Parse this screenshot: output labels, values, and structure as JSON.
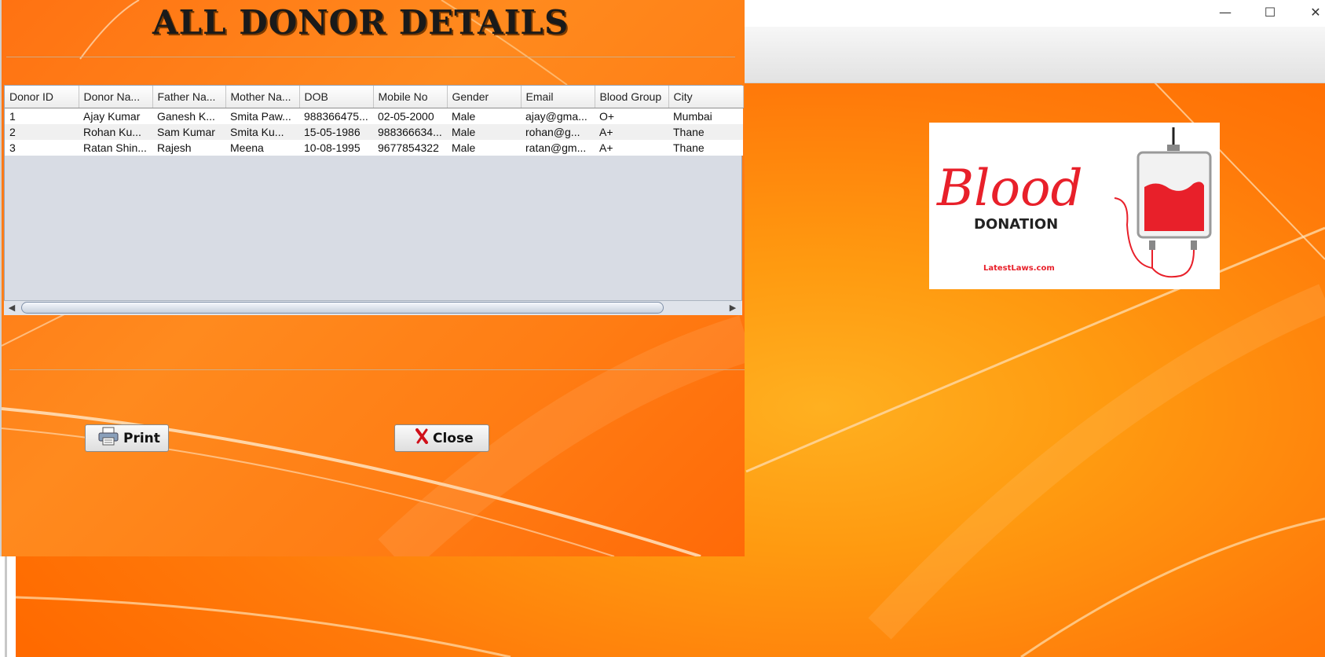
{
  "window": {
    "controls": {
      "minimize": "—",
      "maximize": "☐",
      "close": "✕"
    }
  },
  "dialog": {
    "title": "ALL DONOR DETAILS"
  },
  "table": {
    "columns": [
      "Donor ID",
      "Donor Na...",
      "Father Na...",
      "Mother Na...",
      "DOB",
      "Mobile No",
      "Gender",
      "Email",
      "Blood Group",
      "City"
    ],
    "rows": [
      [
        "1",
        "Ajay Kumar",
        "Ganesh K...",
        "Smita Paw...",
        "988366475...",
        "02-05-2000",
        "Male",
        "ajay@gma...",
        "O+",
        "Mumbai"
      ],
      [
        "2",
        "Rohan Ku...",
        "Sam Kumar",
        "Smita Ku...",
        "15-05-1986",
        "988366634...",
        "Male",
        "rohan@g...",
        "A+",
        "Thane"
      ],
      [
        "3",
        "Ratan Shin...",
        "Rajesh",
        "Meena",
        "10-08-1995",
        "9677854322",
        "Male",
        "ratan@gm...",
        "A+",
        "Thane"
      ]
    ]
  },
  "buttons": {
    "print": {
      "label": "Print",
      "icon": "printer-icon"
    },
    "close": {
      "label": "Close",
      "icon": "close-x-icon"
    }
  },
  "logo": {
    "script_text": "Blood",
    "subtitle": "DONATION",
    "site": "LatestLaws.com",
    "colors": {
      "red": "#e8202a",
      "dark": "#222222"
    }
  },
  "colors": {
    "bg_orange": "#ff7a0a",
    "accent_yellow": "#ffb020"
  }
}
